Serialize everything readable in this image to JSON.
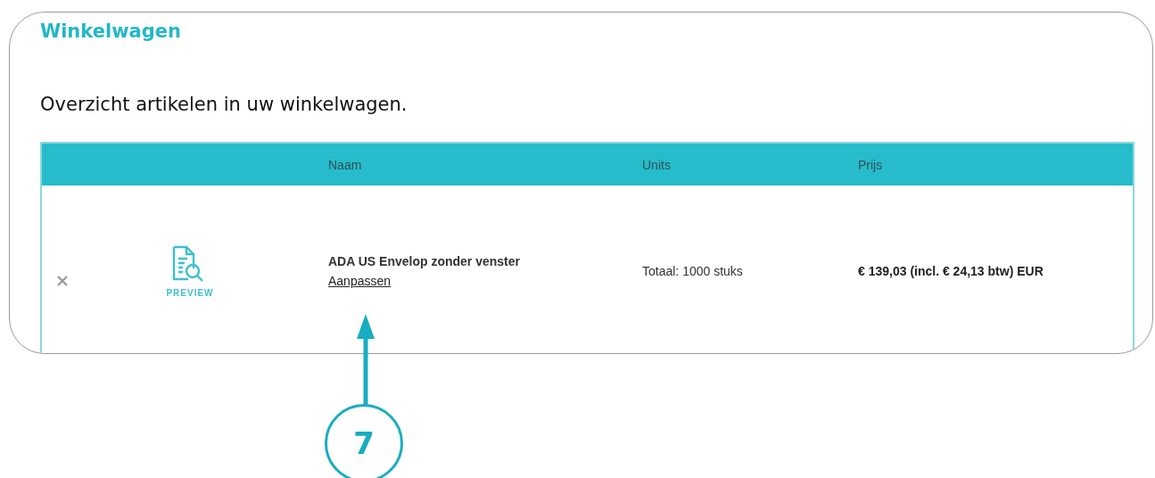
{
  "page_title": "Winkelwagen",
  "intro": "Overzicht artikelen in uw winkelwagen.",
  "table": {
    "columns": [
      "Naam",
      "Units",
      "Prijs"
    ],
    "rows": [
      {
        "preview_label": "PREVIEW",
        "name": "ADA US Envelop zonder venster",
        "edit_link": "Aanpassen",
        "units": "Totaal: 1000 stuks",
        "price": "€ 139,03 (incl. € 24,13 btw) EUR"
      }
    ]
  },
  "callout": {
    "number": "7"
  }
}
